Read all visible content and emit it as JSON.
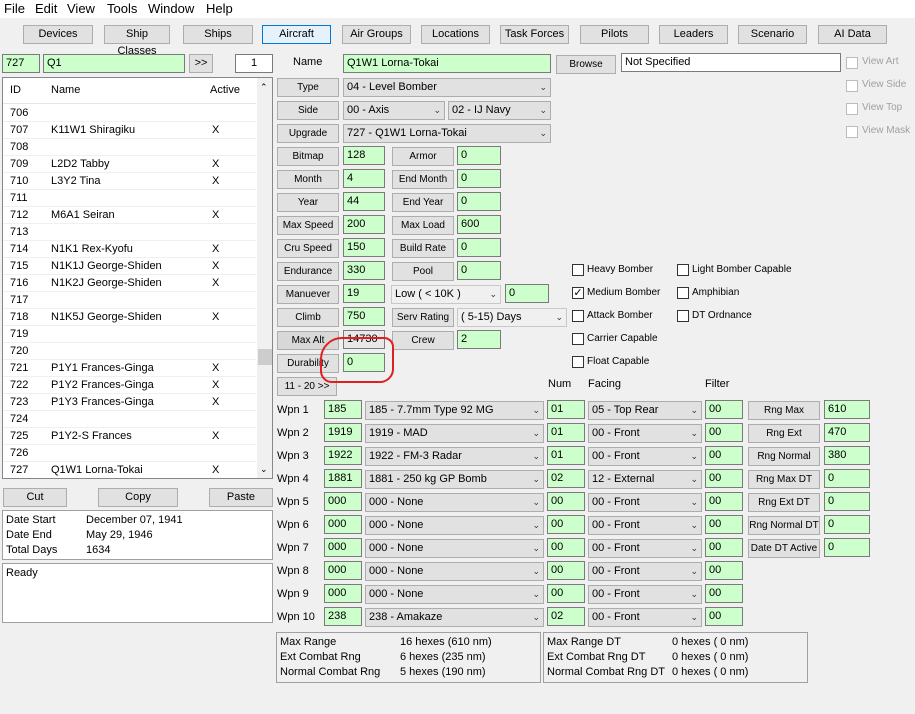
{
  "menu": [
    "File",
    "Edit",
    "View",
    "Tools",
    "Window",
    "Help"
  ],
  "toolbar": [
    "Devices",
    "Ship Classes",
    "Ships",
    "Aircraft",
    "Air Groups",
    "Locations",
    "Task Forces",
    "Pilots",
    "Leaders",
    "Scenario",
    "AI Data"
  ],
  "toolbar_active": "Aircraft",
  "search": {
    "id": "727",
    "text": "Q1",
    "go": ">>",
    "count": "1"
  },
  "list": {
    "headers": {
      "id": "ID",
      "name": "Name",
      "active": "Active"
    },
    "rows": [
      {
        "id": "706",
        "name": "",
        "active": ""
      },
      {
        "id": "707",
        "name": "K11W1 Shiragiku",
        "active": "X"
      },
      {
        "id": "708",
        "name": "",
        "active": ""
      },
      {
        "id": "709",
        "name": "L2D2 Tabby",
        "active": "X"
      },
      {
        "id": "710",
        "name": "L3Y2 Tina",
        "active": "X"
      },
      {
        "id": "711",
        "name": "",
        "active": ""
      },
      {
        "id": "712",
        "name": "M6A1 Seiran",
        "active": "X"
      },
      {
        "id": "713",
        "name": "",
        "active": ""
      },
      {
        "id": "714",
        "name": "N1K1 Rex-Kyofu",
        "active": "X"
      },
      {
        "id": "715",
        "name": "N1K1J George-Shiden",
        "active": "X"
      },
      {
        "id": "716",
        "name": "N1K2J George-Shiden",
        "active": "X"
      },
      {
        "id": "717",
        "name": "",
        "active": ""
      },
      {
        "id": "718",
        "name": "N1K5J George-Shiden",
        "active": "X"
      },
      {
        "id": "719",
        "name": "",
        "active": ""
      },
      {
        "id": "720",
        "name": "",
        "active": ""
      },
      {
        "id": "721",
        "name": "P1Y1 Frances-Ginga",
        "active": "X"
      },
      {
        "id": "722",
        "name": "P1Y2 Frances-Ginga",
        "active": "X"
      },
      {
        "id": "723",
        "name": "P1Y3 Frances-Ginga",
        "active": "X"
      },
      {
        "id": "724",
        "name": "",
        "active": ""
      },
      {
        "id": "725",
        "name": "P1Y2-S Frances",
        "active": "X"
      },
      {
        "id": "726",
        "name": "",
        "active": ""
      },
      {
        "id": "727",
        "name": "Q1W1 Lorna-Tokai",
        "active": "X"
      }
    ]
  },
  "edit_buttons": {
    "cut": "Cut",
    "copy": "Copy",
    "paste": "Paste"
  },
  "dates": {
    "start_label": "Date Start",
    "start": "December 07, 1941",
    "end_label": "Date End",
    "end": "May 29, 1946",
    "total_label": "Total Days",
    "total": "1634"
  },
  "status": "Ready",
  "aircraft": {
    "name_label": "Name",
    "name": "Q1W1 Lorna-Tokai",
    "browse": "Browse",
    "art": "Not Specified",
    "type_label": "Type",
    "type": "04 - Level Bomber",
    "side_label": "Side",
    "side": "00 - Axis",
    "nation": "02 - IJ Navy",
    "upgrade_label": "Upgrade",
    "upgrade": "727 - Q1W1 Lorna-Tokai"
  },
  "view_options": [
    "View Art",
    "View Side",
    "View Top",
    "View Mask"
  ],
  "stats_left": [
    {
      "label": "Bitmap",
      "value": "128"
    },
    {
      "label": "Month",
      "value": "4"
    },
    {
      "label": "Year",
      "value": "44"
    },
    {
      "label": "Max Speed",
      "value": "200"
    },
    {
      "label": "Cru Speed",
      "value": "150"
    },
    {
      "label": "Endurance",
      "value": "330"
    },
    {
      "label": "Manuever",
      "value": "19"
    },
    {
      "label": "Climb",
      "value": "750"
    },
    {
      "label": "Max Alt",
      "value": "14730"
    },
    {
      "label": "Durability",
      "value": "0"
    }
  ],
  "stats_right": [
    {
      "label": "Armor",
      "value": "0"
    },
    {
      "label": "End Month",
      "value": "0"
    },
    {
      "label": "End Year",
      "value": "0"
    },
    {
      "label": "Max Load",
      "value": "600"
    },
    {
      "label": "Build Rate",
      "value": "0"
    },
    {
      "label": "Pool",
      "value": "0"
    }
  ],
  "maneuver_alt": {
    "select": "Low    ( < 10K )",
    "value": "0"
  },
  "serv_rating": {
    "label": "Serv Rating",
    "select": "( 5-15)  Days"
  },
  "crew": {
    "label": "Crew",
    "value": "2"
  },
  "page_button": "11 - 20 >>",
  "roles_col1": [
    {
      "label": "Heavy Bomber",
      "checked": false
    },
    {
      "label": "Medium Bomber",
      "checked": true
    },
    {
      "label": "Attack Bomber",
      "checked": false
    },
    {
      "label": "Carrier Capable",
      "checked": false
    },
    {
      "label": "Float Capable",
      "checked": false
    }
  ],
  "roles_col2": [
    {
      "label": "Light Bomber Capable",
      "checked": false
    },
    {
      "label": "Amphibian",
      "checked": false
    },
    {
      "label": "DT Ordnance",
      "checked": false
    }
  ],
  "weapons_headers": {
    "num": "Num",
    "facing": "Facing",
    "filter": "Filter"
  },
  "weapons": [
    {
      "label": "Wpn 1",
      "id": "185",
      "device": "185 - 7.7mm Type 92 MG",
      "num": "01",
      "facing": "05 - Top Rear",
      "filter": "00"
    },
    {
      "label": "Wpn 2",
      "id": "1919",
      "device": "1919 - MAD",
      "num": "01",
      "facing": "00 - Front",
      "filter": "00"
    },
    {
      "label": "Wpn 3",
      "id": "1922",
      "device": "1922 - FM-3 Radar",
      "num": "01",
      "facing": "00 - Front",
      "filter": "00"
    },
    {
      "label": "Wpn 4",
      "id": "1881",
      "device": "1881 - 250 kg GP Bomb",
      "num": "02",
      "facing": "12 - External",
      "filter": "00"
    },
    {
      "label": "Wpn 5",
      "id": "000",
      "device": "000 - None",
      "num": "00",
      "facing": "00 - Front",
      "filter": "00"
    },
    {
      "label": "Wpn 6",
      "id": "000",
      "device": "000 - None",
      "num": "00",
      "facing": "00 - Front",
      "filter": "00"
    },
    {
      "label": "Wpn 7",
      "id": "000",
      "device": "000 - None",
      "num": "00",
      "facing": "00 - Front",
      "filter": "00"
    },
    {
      "label": "Wpn 8",
      "id": "000",
      "device": "000 - None",
      "num": "00",
      "facing": "00 - Front",
      "filter": "00"
    },
    {
      "label": "Wpn 9",
      "id": "000",
      "device": "000 - None",
      "num": "00",
      "facing": "00 - Front",
      "filter": "00"
    },
    {
      "label": "Wpn 10",
      "id": "238",
      "device": "238 - Amakaze",
      "num": "02",
      "facing": "00 - Front",
      "filter": "00"
    }
  ],
  "ranges": [
    {
      "label": "Rng Max",
      "value": "610"
    },
    {
      "label": "Rng Ext",
      "value": "470"
    },
    {
      "label": "Rng Normal",
      "value": "380"
    },
    {
      "label": "Rng Max DT",
      "value": "0"
    },
    {
      "label": "Rng Ext DT",
      "value": "0"
    },
    {
      "label": "Rng Normal DT",
      "value": "0"
    },
    {
      "label": "Date DT Active",
      "value": "0"
    }
  ],
  "summary_left": [
    {
      "label": "Max Range",
      "value": "16 hexes (610 nm)"
    },
    {
      "label": "Ext Combat Rng",
      "value": "6 hexes (235 nm)"
    },
    {
      "label": "Normal Combat Rng",
      "value": "5 hexes (190 nm)"
    }
  ],
  "summary_right": [
    {
      "label": "Max Range DT",
      "value": "0 hexes ( 0 nm)"
    },
    {
      "label": "Ext Combat Rng DT",
      "value": "0 hexes ( 0 nm)"
    },
    {
      "label": "Normal Combat Rng DT",
      "value": "0 hexes ( 0 nm)"
    }
  ],
  "colors": {
    "field_green": "#ccffcc",
    "annotation": "#e02020",
    "active_tab": "#0078d7"
  }
}
